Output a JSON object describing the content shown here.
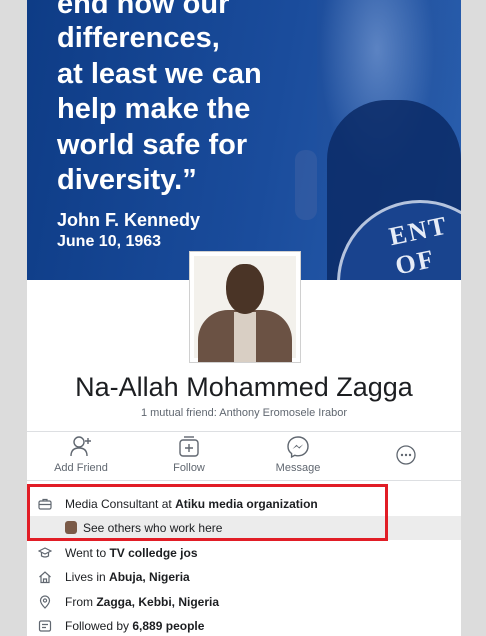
{
  "cover": {
    "quote_top": "end now our",
    "quote_lines": [
      "differences,",
      "at least we can",
      "help make the",
      "world safe for",
      "diversity.”"
    ],
    "attribution_name": "John F. Kennedy",
    "attribution_date": "June 10, 1963",
    "seal_text": "ENT OF"
  },
  "profile": {
    "name": "Na-Allah Mohammed Zagga",
    "mutual_friends": "1 mutual friend: Anthony Eromosele Irabor"
  },
  "actions": [
    {
      "label": "Add Friend",
      "icon": "add-friend-icon"
    },
    {
      "label": "Follow",
      "icon": "follow-icon"
    },
    {
      "label": "Message",
      "icon": "messenger-icon"
    },
    {
      "label": "",
      "icon": "more-icon"
    }
  ],
  "details": {
    "work_prefix": "Media Consultant at ",
    "work_org": "Atiku media organization",
    "see_others": "See others who work here",
    "education_prefix": "Went to ",
    "education_school": "TV colledge jos",
    "lives_prefix": "Lives in ",
    "lives_place": "Abuja, Nigeria",
    "from_prefix": "From ",
    "from_place": "Zagga, Kebbi, Nigeria",
    "followed_prefix": "Followed by ",
    "followed_count": "6,889 people"
  },
  "colors": {
    "highlight": "#e11d26",
    "cover_blue": "#1a4c9c"
  }
}
